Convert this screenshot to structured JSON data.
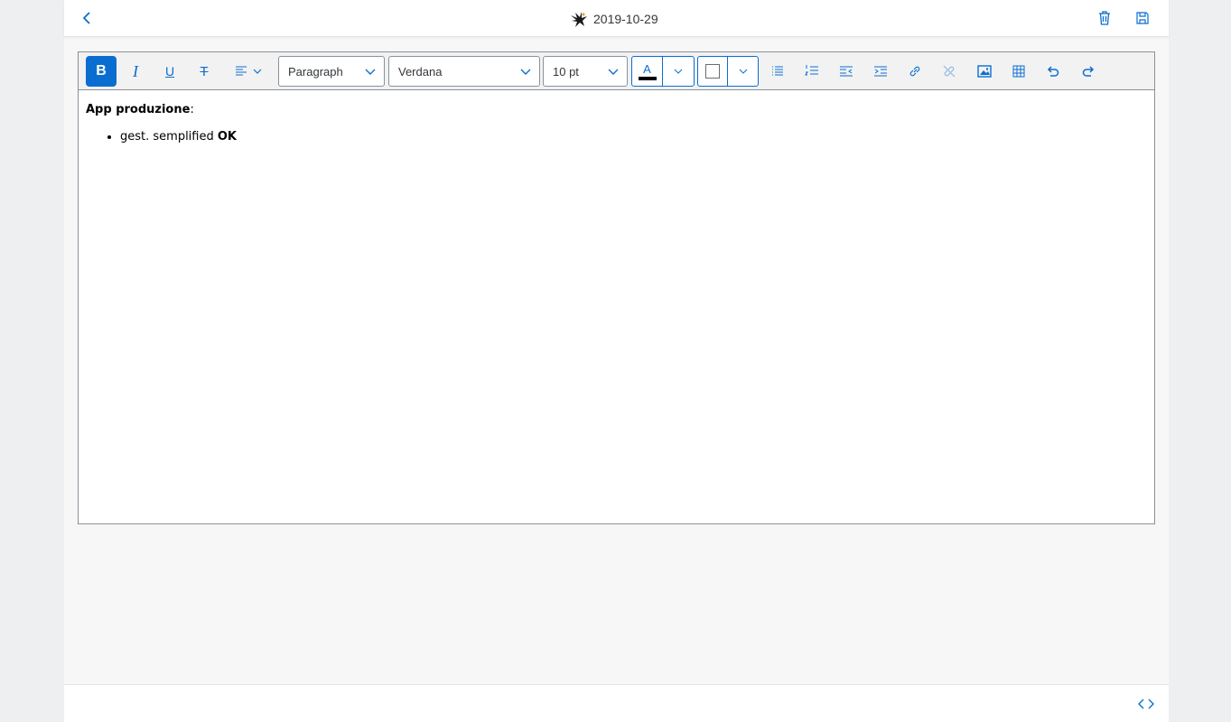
{
  "header": {
    "title": "2019-10-29",
    "back_icon": "chevron-left-icon",
    "title_icon": "eagle-logo-icon",
    "delete_icon": "trash-icon",
    "save_icon": "save-icon"
  },
  "toolbar": {
    "bold_label": "B",
    "italic_label": "I",
    "underline_label": "U",
    "strike_label": "T",
    "paragraph_format": "Paragraph",
    "font_family": "Verdana",
    "font_size": "10 pt",
    "text_color_label": "A",
    "accent_color": "#0a6ed1",
    "text_color": "#000000"
  },
  "content": {
    "heading_bold": "App produzione",
    "heading_rest": ":",
    "bullets": [
      {
        "text": "gest. semplified ",
        "bold": "OK"
      }
    ]
  },
  "footer": {
    "code_icon": "code-toggle-icon"
  }
}
